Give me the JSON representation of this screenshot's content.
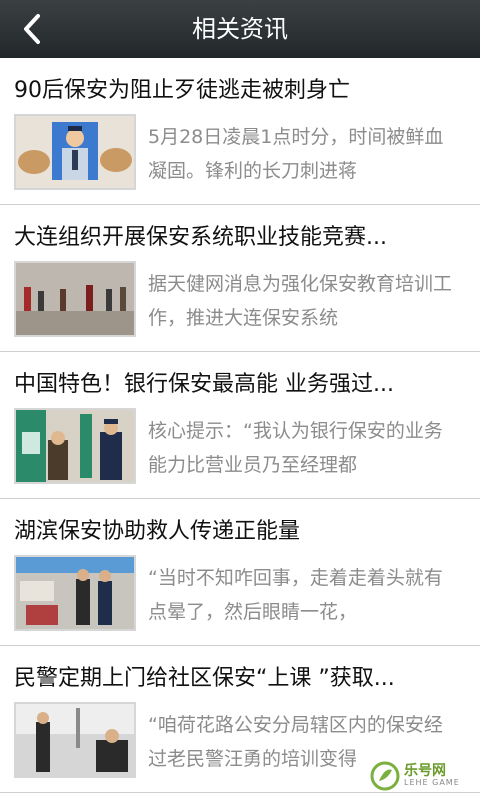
{
  "header": {
    "title": "相关资讯"
  },
  "items": [
    {
      "title": "90后保安为阻止歹徒逃走被刺身亡",
      "summary": "5月28日凌晨1点时分，时间被鲜血凝固。锋利的长刀刺进蒋",
      "thumb": "guard-portrait"
    },
    {
      "title": "大连组织开展保安系统职业技能竞赛...",
      "summary": "据天健网消息为强化保安教育培训工作，推进大连保安系统",
      "thumb": "training-hall"
    },
    {
      "title": "中国特色！银行保安最高能 业务强过...",
      "summary": "核心提示：“我认为银行保安的业务能力比营业员乃至经理都",
      "thumb": "bank-atm"
    },
    {
      "title": "湖滨保安协助救人传递正能量",
      "summary": "“当时不知咋回事，走着走着头就有点晕了，然后眼睛一花，",
      "thumb": "rescue-scene"
    },
    {
      "title": "民警定期上门给社区保安“上课 ”获取...",
      "summary": "“咱荷花路公安分局辖区内的保安经过老民警汪勇的培训变得",
      "thumb": "street-police"
    }
  ],
  "watermark": {
    "brand": "乐号网",
    "sub": "LEHE GAME"
  }
}
